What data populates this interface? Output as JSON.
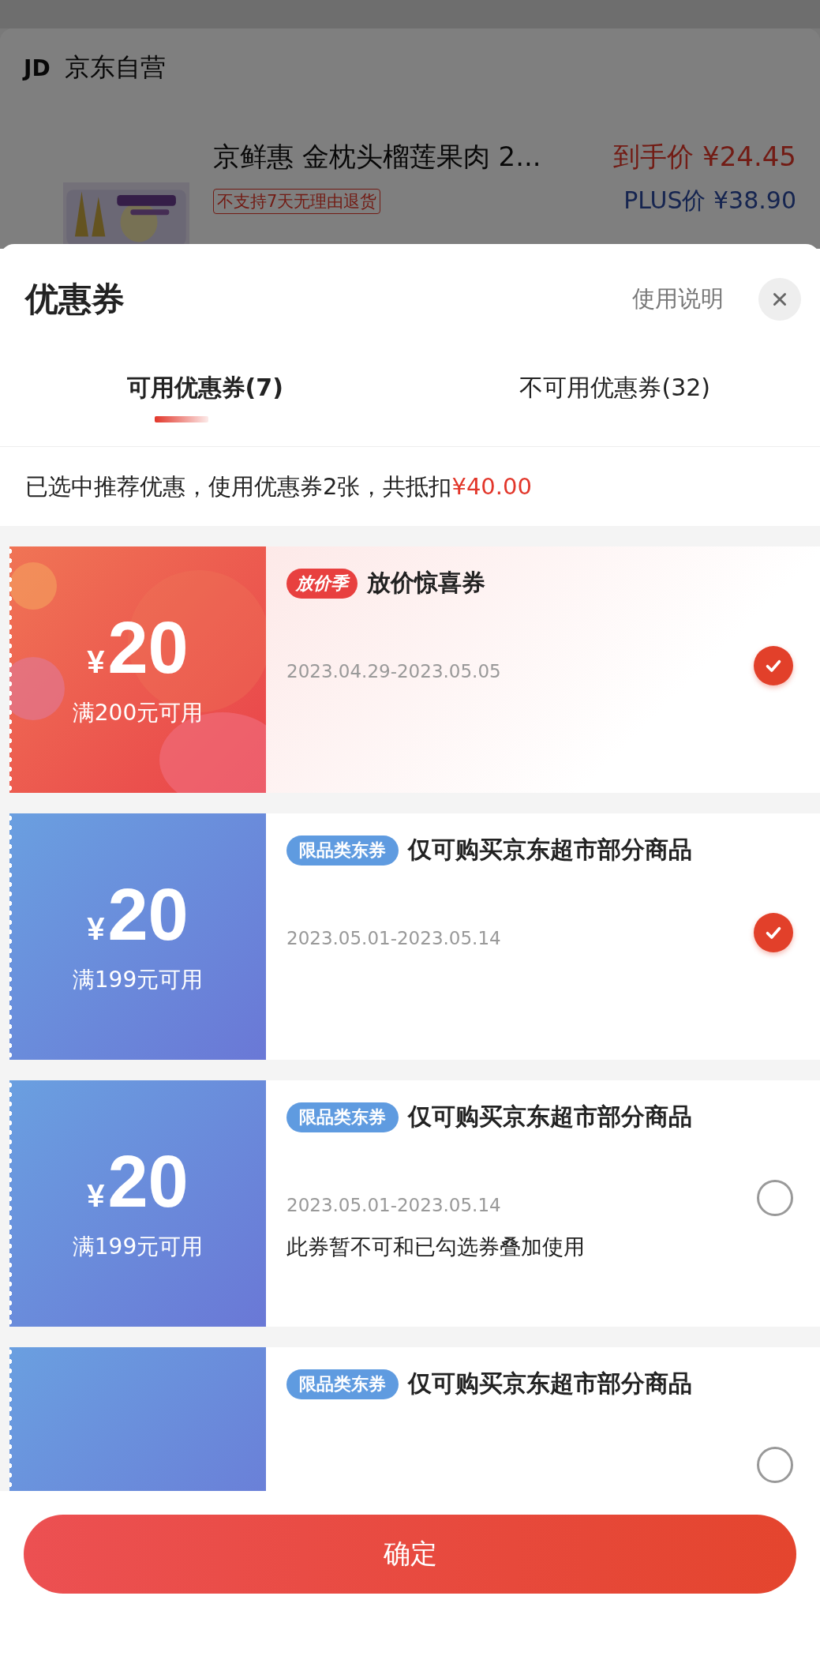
{
  "store": {
    "logo": "JD",
    "name": "京东自营"
  },
  "product": {
    "title": "京鲜惠 金枕头榴莲果肉 2...",
    "price": "到手价 ¥24.45",
    "tag": "不支持7天无理由退货",
    "plus_price": "PLUS价 ¥38.90"
  },
  "sheet": {
    "title": "优惠券",
    "help_link": "使用说明"
  },
  "tabs": [
    {
      "label": "可用优惠券(7)",
      "selected": true
    },
    {
      "label": "不可用优惠券(32)",
      "selected": false
    }
  ],
  "summary_prefix": "已选中推荐优惠，使用优惠券2张，共抵扣",
  "summary_amount": "¥40.00",
  "coupons": [
    {
      "kind": "festival",
      "currency": "¥",
      "amount": "20",
      "condition": "满200元可用",
      "badge": "放价季",
      "title": "放价惊喜券",
      "dates": "2023.04.29-2023.05.05",
      "selected": true
    },
    {
      "kind": "category",
      "currency": "¥",
      "amount": "20",
      "condition": "满199元可用",
      "badge": "限品类东券",
      "title": "仅可购买京东超市部分商品",
      "dates": "2023.05.01-2023.05.14",
      "selected": true
    },
    {
      "kind": "category",
      "currency": "¥",
      "amount": "20",
      "condition": "满199元可用",
      "badge": "限品类东券",
      "title": "仅可购买京东超市部分商品",
      "dates": "2023.05.01-2023.05.14",
      "note": "此券暂不可和已勾选券叠加使用",
      "selected": false
    },
    {
      "kind": "category",
      "badge": "限品类东券",
      "title": "仅可购买京东超市部分商品",
      "selected": false
    }
  ],
  "confirm_button": "确定"
}
